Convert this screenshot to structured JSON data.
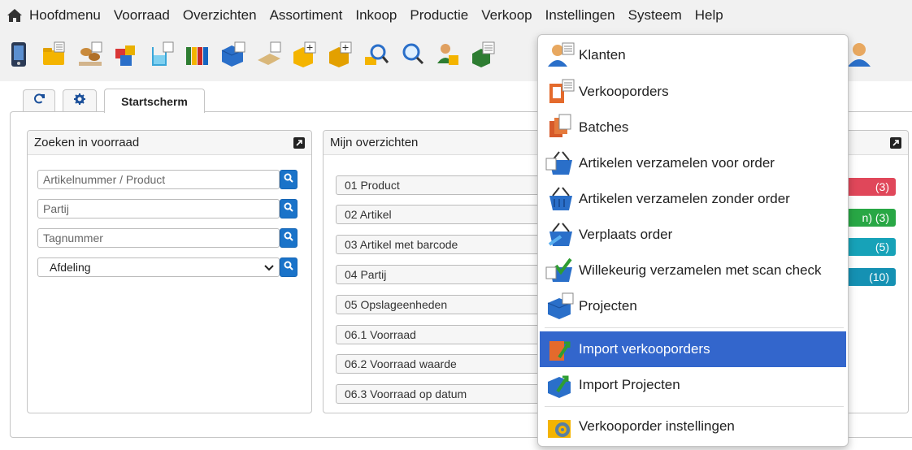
{
  "menubar": {
    "home_icon": "home-icon",
    "items": [
      "Hoofdmenu",
      "Voorraad",
      "Overzichten",
      "Assortiment",
      "Inkoop",
      "Productie",
      "Verkoop",
      "Instellingen",
      "Systeem",
      "Help"
    ]
  },
  "toolbar": {
    "icons": [
      "device-icon",
      "folder-icon",
      "pallet-icon",
      "boxes-icon",
      "beaker-icon",
      "binders-icon",
      "blue-box-icon",
      "pallet-flat-icon",
      "box-add-icon",
      "box-add-2-icon",
      "search-icon",
      "search-2-icon",
      "user-box-icon",
      "doc-box-icon"
    ],
    "right_icon": "user-icon"
  },
  "tabs": {
    "refresh_icon": "refresh-icon",
    "settings_icon": "gear-icon",
    "active_label": "Startscherm"
  },
  "search_panel": {
    "title": "Zoeken in voorraad",
    "fields": [
      {
        "placeholder": "Artikelnummer / Product"
      },
      {
        "placeholder": "Partij"
      },
      {
        "placeholder": "Tagnummer"
      }
    ],
    "select": {
      "value": "Afdeling"
    }
  },
  "overview_panel": {
    "title": "Mijn overzichten",
    "items": [
      "01 Product",
      "02 Artikel",
      "03 Artikel met barcode",
      "04 Partij",
      "05 Opslageenheden",
      "06.1 Voorraad",
      "06.2 Voorraad waarde",
      "06.3 Voorraad op datum"
    ]
  },
  "right_panel": {
    "badges": [
      {
        "text": "(3)",
        "color": "#e0475a"
      },
      {
        "text": "n)  (3)",
        "color": "#28a745"
      },
      {
        "text": "(5)",
        "color": "#17a2b8"
      },
      {
        "text": "(10)",
        "color": "#1591b3"
      }
    ]
  },
  "dropdown": {
    "items": [
      {
        "label": "Klanten",
        "icon": "customer-icon"
      },
      {
        "label": "Verkooporders",
        "icon": "sales-order-icon"
      },
      {
        "label": "Batches",
        "icon": "batches-icon"
      },
      {
        "label": "Artikelen verzamelen voor order",
        "icon": "basket-order-icon"
      },
      {
        "label": "Artikelen verzamelen zonder order",
        "icon": "basket-icon"
      },
      {
        "label": "Verplaats order",
        "icon": "move-order-icon"
      },
      {
        "label": "Willekeurig verzamelen met scan check",
        "icon": "scan-check-icon"
      },
      {
        "label": "Projecten",
        "icon": "projects-icon"
      },
      {
        "label": "Import verkooporders",
        "icon": "import-sales-icon",
        "selected": true
      },
      {
        "label": "Import Projecten",
        "icon": "import-projects-icon"
      },
      {
        "label": "Verkooporder instellingen",
        "icon": "settings-gear-icon"
      }
    ],
    "selected_color": "#3366cc"
  }
}
